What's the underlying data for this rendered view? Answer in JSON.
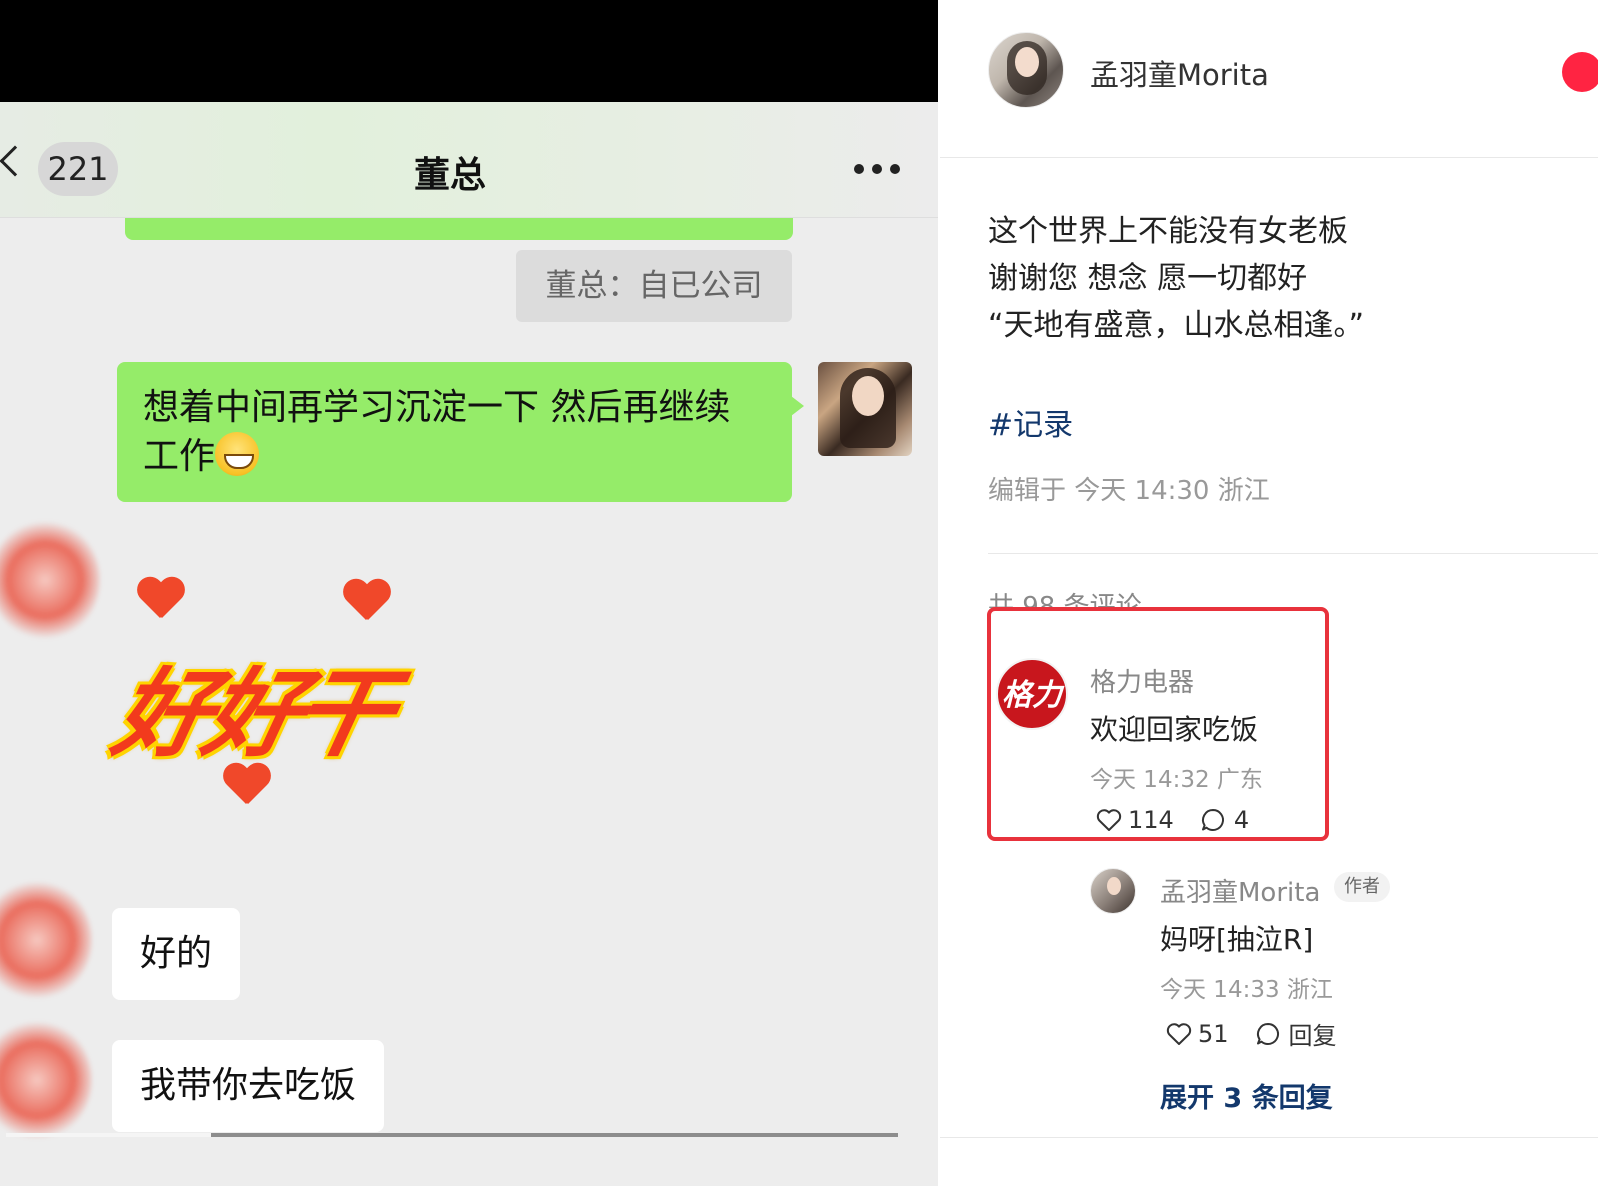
{
  "video": {
    "chat": {
      "back_count": "221",
      "title": "董总",
      "system_note": "董总：自已公司",
      "my_message_line1": "想着中间再学习沉淀一下 然后再继续",
      "my_message_line2": "工作",
      "sticker_text": "好好干",
      "reply_1": "好的",
      "reply_2": "我带你去吃饭"
    },
    "progress": 0.23
  },
  "post": {
    "author": "孟羽童Morita",
    "lines": [
      "这个世界上不能没有女老板",
      "谢谢您 想念 愿一切都好",
      "“天地有盛意，山水总相逢。”"
    ],
    "hashtag": "#记录",
    "meta": "编辑于 今天 14:30 浙江"
  },
  "comments": {
    "count_label": "共 98 条评论",
    "top": {
      "logo_text": "格力",
      "name": "格力电器",
      "text": "欢迎回家吃饭",
      "time": "今天 14:32 广东",
      "likes": "114",
      "replies": "4"
    },
    "reply": {
      "name": "孟羽童Morita",
      "tag": "作者",
      "text": "妈呀[抽泣R]",
      "time": "今天 14:33 浙江",
      "likes": "51",
      "reply_label": "回复"
    },
    "expand_label": "展开 3 条回复"
  },
  "colors": {
    "wechat_green": "#95ec69",
    "highlight_red": "#e8323c",
    "link_blue": "#13386c",
    "gree_red": "#c8161d"
  }
}
